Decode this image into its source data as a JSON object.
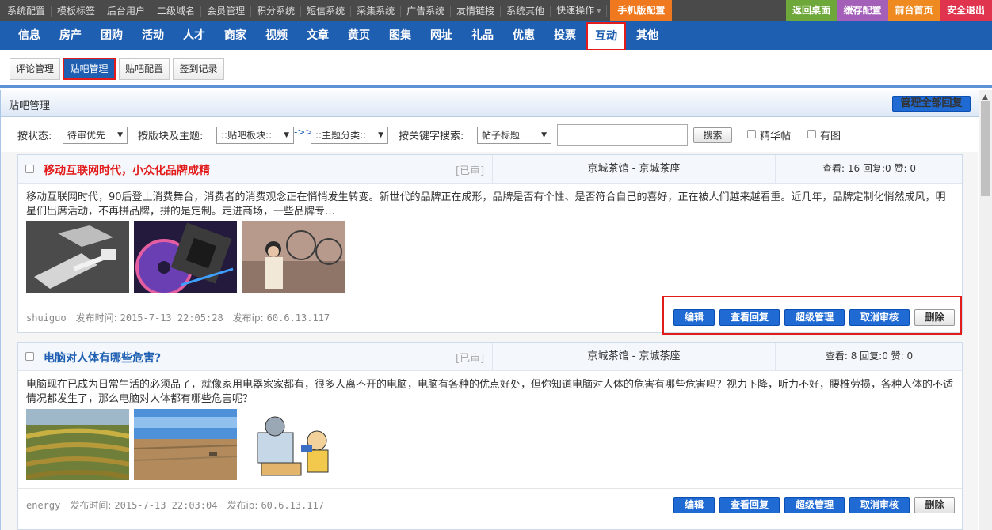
{
  "topbar": {
    "left_links": [
      "系统配置",
      "模板标签",
      "后台用户",
      "二级域名",
      "会员管理",
      "积分系统",
      "短信系统",
      "采集系统",
      "广告系统",
      "友情链接",
      "系统其他",
      "快速操作"
    ],
    "mobile_config": "手机版配置",
    "right_links": [
      {
        "label": "返回桌面",
        "color": "#6fa83a"
      },
      {
        "label": "缓存配置",
        "color": "#a45fb8"
      },
      {
        "label": "前台首页",
        "color": "#ee8a1f"
      },
      {
        "label": "安全退出",
        "color": "#e0334d"
      }
    ]
  },
  "main_nav": {
    "items": [
      "信息",
      "房产",
      "团购",
      "活动",
      "人才",
      "商家",
      "视频",
      "文章",
      "黄页",
      "图集",
      "网址",
      "礼品",
      "优惠",
      "投票",
      "互动",
      "其他"
    ],
    "active": "互动"
  },
  "sub_nav": {
    "items": [
      "评论管理",
      "贴吧管理",
      "贴吧配置",
      "签到记录"
    ],
    "active": "贴吧管理"
  },
  "panel": {
    "title": "贴吧管理",
    "reply_all_button": "管理全部回复"
  },
  "filters": {
    "status_label": "按状态:",
    "status_value": "待审优先",
    "section_label": "按版块及主题:",
    "section_value": "::贴吧板块::",
    "arrow": "->>",
    "topic_value": "::主题分类::",
    "keyword_label": "按关键字搜索:",
    "keyword_field_value": "帖子标题",
    "keyword_input": "",
    "search_button": "搜索",
    "featured_label": "精华帖",
    "has_image_label": "有图"
  },
  "posts": [
    {
      "title": "移动互联网时代，小众化品牌成精",
      "title_color": "#e21b1b",
      "status": "[已审]",
      "forum": "京城茶馆 - 京城茶座",
      "stats": "查看: 16   回复:0   赞: 0",
      "body": "移动互联网时代，90后登上消费舞台，消费者的消费观念正在悄悄发生转变。新世代的品牌正在成形，品牌是否有个性、是否符合自己的喜好，正在被人们越来越看重。近几年，品牌定制化悄然成风，明星们出席活动，不再拼品牌，拼的是定制。走进商场，一些品牌专…",
      "images": [
        "usb-cable-photo",
        "cd-chip-photo",
        "woman-bicycle-photo"
      ],
      "author": "shuiguo",
      "time_label": "发布时间:",
      "time": "2015-7-13 22:05:28",
      "ip_label": "发布ip:",
      "ip": "60.6.13.117",
      "actions": [
        "编辑",
        "查看回复",
        "超级管理",
        "取消审核",
        "删除"
      ]
    },
    {
      "title": "电脑对人体有哪些危害?",
      "title_color": "#1f5fb2",
      "status": "[已审]",
      "forum": "京城茶馆 - 京城茶座",
      "stats": "查看: 8   回复:0   赞: 0",
      "body": "电脑现在已成为日常生活的必须品了，就像家用电器家家都有，很多人离不开的电脑，电脑有各种的优点好处，但你知道电脑对人体的危害有哪些危害吗？视力下降，听力不好，腰椎劳损，各种人体的不适情况都发生了，那么电脑对人体都有哪些危害呢？",
      "images": [
        "terraced-field-photo",
        "dry-land-photo",
        "computer-cartoon"
      ],
      "author": "energy",
      "time_label": "发布时间:",
      "time": "2015-7-13 22:03:04",
      "ip_label": "发布ip:",
      "ip": "60.6.13.117",
      "actions": [
        "编辑",
        "查看回复",
        "超级管理",
        "取消审核",
        "删除"
      ]
    }
  ]
}
